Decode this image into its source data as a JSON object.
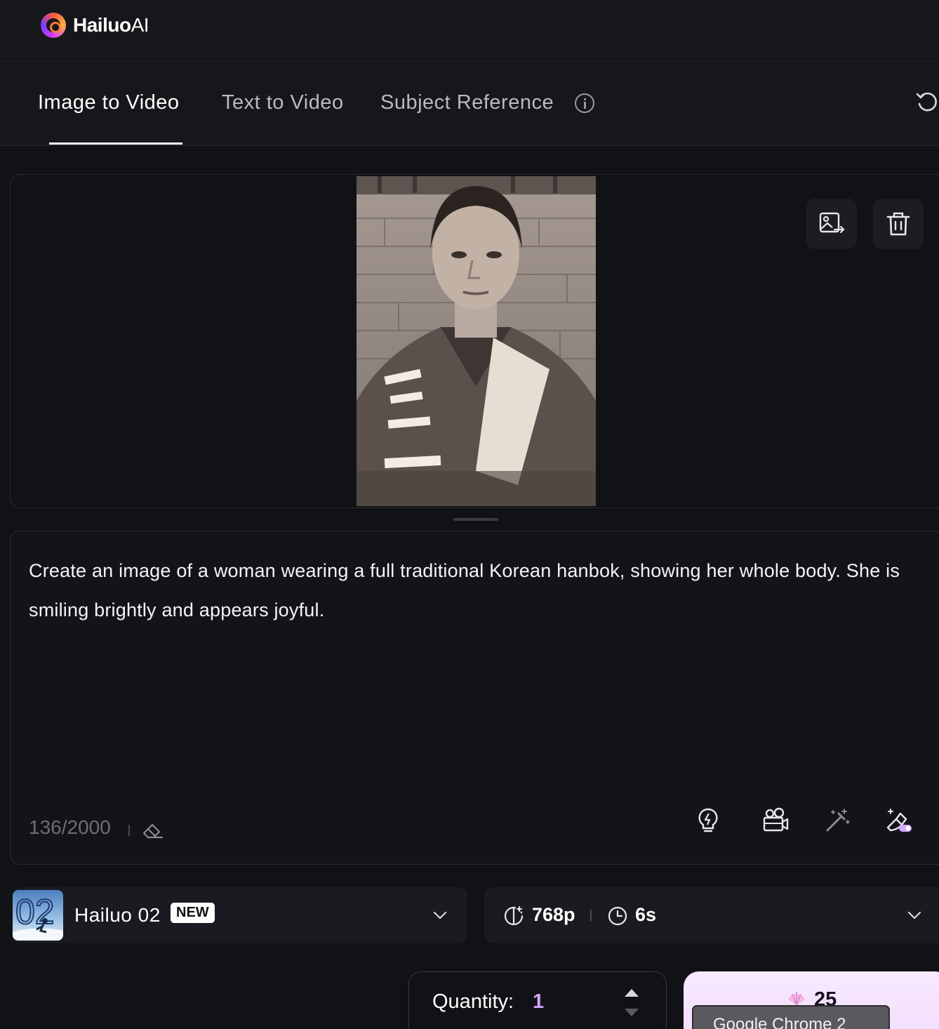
{
  "header": {
    "brand": "Hailuo",
    "brand_suffix": "AI"
  },
  "tabs": [
    {
      "label": "Image to Video",
      "active": true
    },
    {
      "label": "Text to Video",
      "active": false
    },
    {
      "label": "Subject Reference",
      "active": false
    }
  ],
  "prompt": {
    "text": "Create an image of a woman wearing a full traditional Korean hanbok, showing her whole body. She is smiling brightly and appears joyful.",
    "counter": "136/2000"
  },
  "model": {
    "name": "Hailuo 02",
    "badge": "NEW",
    "thumb_text": "02"
  },
  "settings": {
    "resolution": "768p",
    "duration": "6s"
  },
  "quantity": {
    "label": "Quantity:",
    "value": "1"
  },
  "generate": {
    "credits": "25"
  },
  "tooltip": {
    "text": "Google Chrome 2"
  },
  "colors": {
    "accent": "#d6a3ff",
    "background": "#111216",
    "panel": "#1a1b20",
    "generate_bg": "#f4e2fe"
  }
}
